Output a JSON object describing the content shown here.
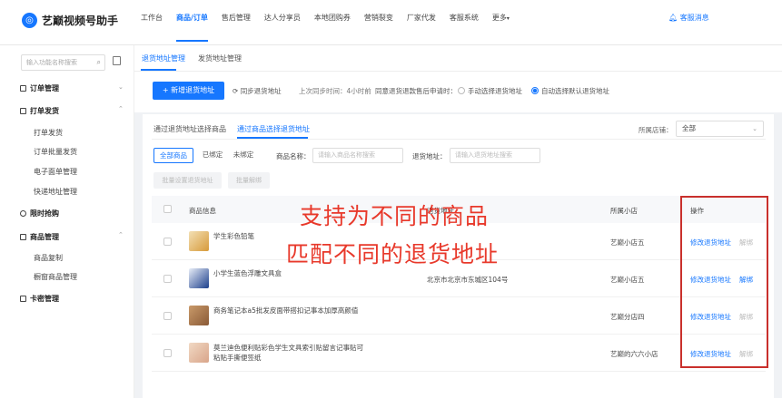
{
  "app": {
    "logo_text": "艺巅视频号助手"
  },
  "nav": [
    {
      "label": "工作台"
    },
    {
      "label": "商品/订单"
    },
    {
      "label": "售后管理"
    },
    {
      "label": "达人分享员"
    },
    {
      "label": "本地团购券"
    },
    {
      "label": "营销裂变"
    },
    {
      "label": "厂家代发"
    },
    {
      "label": "客服系统"
    },
    {
      "label": "更多"
    }
  ],
  "header": {
    "service_msg": "客服消息"
  },
  "sidebar": {
    "search_placeholder": "输入功能名称搜索",
    "groups": [
      {
        "label": "订单管理"
      },
      {
        "label": "打单发货",
        "items": [
          "打单发货",
          "订单批量发货",
          "电子面单管理",
          "快递地址管理"
        ]
      },
      {
        "label": "限时抢购"
      },
      {
        "label": "商品管理",
        "items": [
          "商品复制",
          "橱窗商品管理"
        ]
      },
      {
        "label": "卡密管理"
      }
    ]
  },
  "subtabs": [
    "退货地址管理",
    "发货地址管理"
  ],
  "actions": {
    "new_button": "+ 新增退货地址",
    "sync": "同步退货地址",
    "last_sync": "上次同步时间：4小时前",
    "agree_label": "同意退货退款售后申请时：",
    "radio_manual": "手动选择退货地址",
    "radio_auto": "自动选择默认退货地址"
  },
  "panel": {
    "tabs": [
      "通过退货地址选择商品",
      "通过商品选择退货地址"
    ],
    "store_label": "所属店铺：",
    "store_value": "全部",
    "filters": [
      "全部商品",
      "已绑定",
      "未绑定"
    ],
    "product_name_label": "商品名称：",
    "product_name_placeholder": "请输入商品名称搜索",
    "return_addr_label": "退货地址：",
    "return_addr_placeholder": "请输入退货地址搜索",
    "bulk_set": "批量设置退货地址",
    "bulk_unbind": "批量解绑"
  },
  "table": {
    "headers": {
      "info": "商品信息",
      "address": "退货地址",
      "shop": "所属小店",
      "op": "操作"
    },
    "rows": [
      {
        "name": "学生彩色铅笔",
        "address": "",
        "shop": "艺巅小店五",
        "op1": "修改退货地址",
        "op2": "解绑",
        "op2_enabled": false
      },
      {
        "name": "小学生蓝色浮雕文具盒",
        "address": "北京市北京市东城区104号",
        "shop": "艺巅小店五",
        "op1": "修改退货地址",
        "op2": "解绑",
        "op2_enabled": true
      },
      {
        "name": "商务笔记本a5批发皮面带搭扣记事本加厚高颜值",
        "address": "",
        "shop": "艺巅分店四",
        "op1": "修改退货地址",
        "op2": "解绑",
        "op2_enabled": false
      },
      {
        "name": "莫兰迪色便利贴彩色学生文具索引贴留言记事贴可粘贴手撕便签纸",
        "address": "",
        "shop": "艺巅的六六小店",
        "op1": "修改退货地址",
        "op2": "解绑",
        "op2_enabled": false
      }
    ]
  },
  "overlay": {
    "line1": "支持为不同的商品",
    "line2": "匹配不同的退货地址"
  },
  "colors": {
    "accent": "#1677ff",
    "highlight": "#e8392b"
  }
}
